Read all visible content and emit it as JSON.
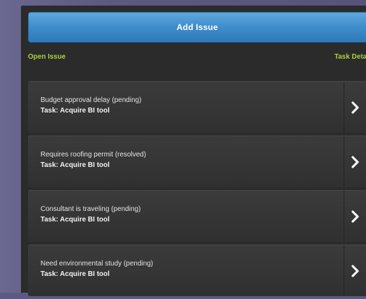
{
  "toolbar": {
    "add_issue_label": "Add Issue"
  },
  "tabs": {
    "left_label": "Open Issue",
    "right_label": "Task Detai"
  },
  "issues": [
    {
      "title": "Budget approval delay (pending)",
      "task": "Task: Acquire BI tool"
    },
    {
      "title": "Requires roofing permit (resolved)",
      "task": "Task: Acquire BI tool"
    },
    {
      "title": "Consultant is traveling (pending)",
      "task": "Task: Acquire BI tool"
    },
    {
      "title": "Need environmental study (pending)",
      "task": "Task: Acquire BI tool"
    }
  ],
  "colors": {
    "accent_green": "#a8d23a",
    "button_blue": "#3f8ccc",
    "panel_bg": "#2b2b2b"
  },
  "icons": {
    "row_disclosure": "chevron-right-icon"
  }
}
